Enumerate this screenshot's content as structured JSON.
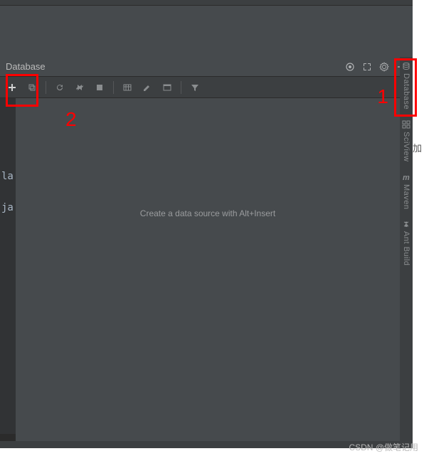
{
  "panel": {
    "title": "Database",
    "hint": "Create a data source with Alt+Insert"
  },
  "sidebar": {
    "items": [
      {
        "label": "Database"
      },
      {
        "label": "SciView"
      },
      {
        "label": "Maven"
      },
      {
        "label": "Ant Build"
      }
    ]
  },
  "gutter": {
    "frag1": "la",
    "frag2": "ja"
  },
  "annotations": {
    "n1": "1",
    "n2": "2"
  },
  "watermark": "CSDN @做笔记用",
  "outside_char": "加"
}
